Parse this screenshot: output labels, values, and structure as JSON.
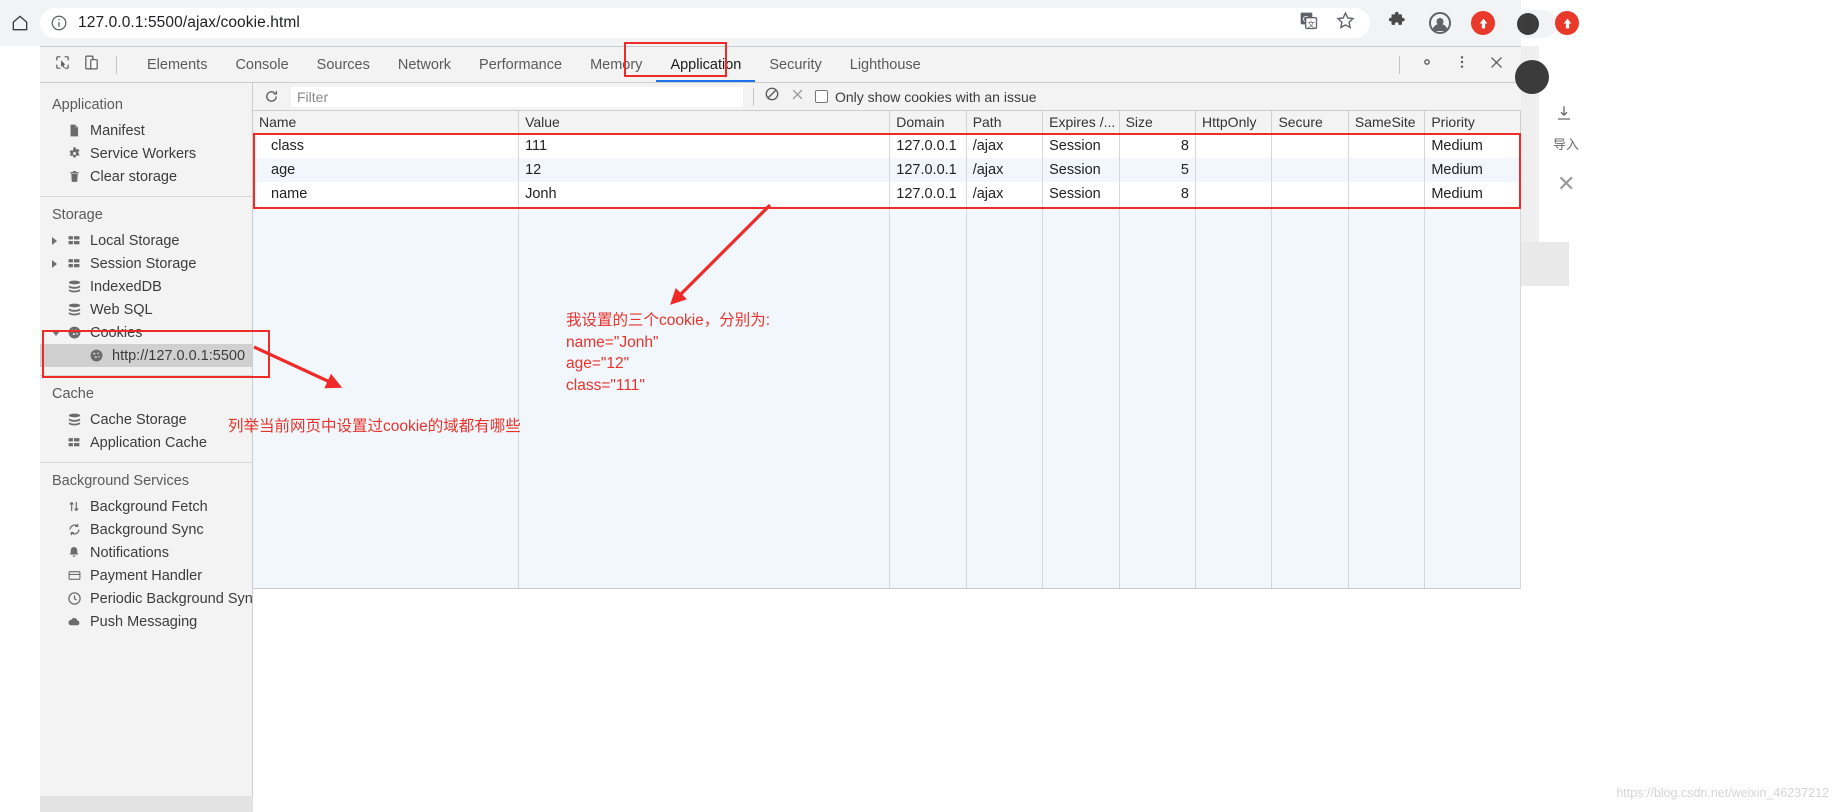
{
  "browser": {
    "url": "127.0.0.1:5500/ajax/cookie.html",
    "home_icon": "home-icon",
    "info_icon": "page-info-icon",
    "translate_icon": "translate-icon",
    "bookmark_icon": "star-icon",
    "extensions_icon": "puzzle-icon",
    "profile_icon": "profile-avatar-icon",
    "extension_red_icon": "red-extension-icon"
  },
  "devtools": {
    "inspect_icon": "inspect-element-icon",
    "device_icon": "device-toolbar-icon",
    "settings_icon": "gear-icon",
    "more_icon": "more-vertical-icon",
    "close_icon": "close-icon",
    "tabs": [
      {
        "label": "Elements",
        "active": false
      },
      {
        "label": "Console",
        "active": false
      },
      {
        "label": "Sources",
        "active": false
      },
      {
        "label": "Network",
        "active": false
      },
      {
        "label": "Performance",
        "active": false
      },
      {
        "label": "Memory",
        "active": false
      },
      {
        "label": "Application",
        "active": true
      },
      {
        "label": "Security",
        "active": false
      },
      {
        "label": "Lighthouse",
        "active": false
      }
    ]
  },
  "sidebar": {
    "sections": [
      {
        "title": "Application",
        "items": [
          {
            "label": "Manifest",
            "icon": "manifest-file-icon",
            "indent": 0,
            "arrow": "none",
            "selected": false
          },
          {
            "label": "Service Workers",
            "icon": "gear-icon",
            "indent": 0,
            "arrow": "none",
            "selected": false
          },
          {
            "label": "Clear storage",
            "icon": "trash-icon",
            "indent": 0,
            "arrow": "none",
            "selected": false
          }
        ]
      },
      {
        "title": "Storage",
        "items": [
          {
            "label": "Local Storage",
            "icon": "grid-storage-icon",
            "indent": 0,
            "arrow": "closed",
            "selected": false
          },
          {
            "label": "Session Storage",
            "icon": "grid-storage-icon",
            "indent": 0,
            "arrow": "closed",
            "selected": false
          },
          {
            "label": "IndexedDB",
            "icon": "database-icon",
            "indent": 0,
            "arrow": "none",
            "selected": false
          },
          {
            "label": "Web SQL",
            "icon": "database-icon",
            "indent": 0,
            "arrow": "none",
            "selected": false
          },
          {
            "label": "Cookies",
            "icon": "cookie-icon",
            "indent": 0,
            "arrow": "open",
            "selected": false
          },
          {
            "label": "http://127.0.0.1:5500",
            "icon": "cookie-icon",
            "indent": 1,
            "arrow": "none",
            "selected": true
          }
        ]
      },
      {
        "title": "Cache",
        "items": [
          {
            "label": "Cache Storage",
            "icon": "database-icon",
            "indent": 0,
            "arrow": "none",
            "selected": false
          },
          {
            "label": "Application Cache",
            "icon": "grid-storage-icon",
            "indent": 0,
            "arrow": "none",
            "selected": false
          }
        ]
      },
      {
        "title": "Background Services",
        "items": [
          {
            "label": "Background Fetch",
            "icon": "up-down-arrows-icon",
            "indent": 0,
            "arrow": "none",
            "selected": false
          },
          {
            "label": "Background Sync",
            "icon": "sync-icon",
            "indent": 0,
            "arrow": "none",
            "selected": false
          },
          {
            "label": "Notifications",
            "icon": "bell-icon",
            "indent": 0,
            "arrow": "none",
            "selected": false
          },
          {
            "label": "Payment Handler",
            "icon": "credit-card-icon",
            "indent": 0,
            "arrow": "none",
            "selected": false
          },
          {
            "label": "Periodic Background Sync",
            "icon": "clock-icon",
            "indent": 0,
            "arrow": "none",
            "selected": false
          },
          {
            "label": "Push Messaging",
            "icon": "cloud-icon",
            "indent": 0,
            "arrow": "none",
            "selected": false
          }
        ]
      }
    ]
  },
  "toolbar": {
    "refresh_icon": "refresh-icon",
    "filter_placeholder": "Filter",
    "filter_value": "",
    "clear_all_icon": "block-clear-icon",
    "delete_icon": "x-delete-icon",
    "only_issues_label": "Only show cookies with an issue",
    "only_issues_checked": false
  },
  "cookies_table": {
    "columns": [
      "Name",
      "Value",
      "Domain",
      "Path",
      "Expires /...",
      "Size",
      "HttpOnly",
      "Secure",
      "SameSite",
      "Priority"
    ],
    "rows": [
      {
        "name": "class",
        "value": "111",
        "domain": "127.0.0.1",
        "path": "/ajax",
        "expires": "Session",
        "size": "8",
        "httponly": "",
        "secure": "",
        "samesite": "",
        "priority": "Medium"
      },
      {
        "name": "age",
        "value": "12",
        "domain": "127.0.0.1",
        "path": "/ajax",
        "expires": "Session",
        "size": "5",
        "httponly": "",
        "secure": "",
        "samesite": "",
        "priority": "Medium"
      },
      {
        "name": "name",
        "value": "Jonh",
        "domain": "127.0.0.1",
        "path": "/ajax",
        "expires": "Session",
        "size": "8",
        "httponly": "",
        "secure": "",
        "samesite": "",
        "priority": "Medium"
      }
    ]
  },
  "annotations": {
    "cookie_note": "我设置的三个cookie，分别为:\nname=\"Jonh\"\nage=\"12\"\nclass=\"111\"",
    "domain_note": "列举当前网页中设置过cookie的域都有哪些",
    "highlight_color": "#ee2b26"
  },
  "watermark": "https://blog.csdn.net/weixin_46237212"
}
